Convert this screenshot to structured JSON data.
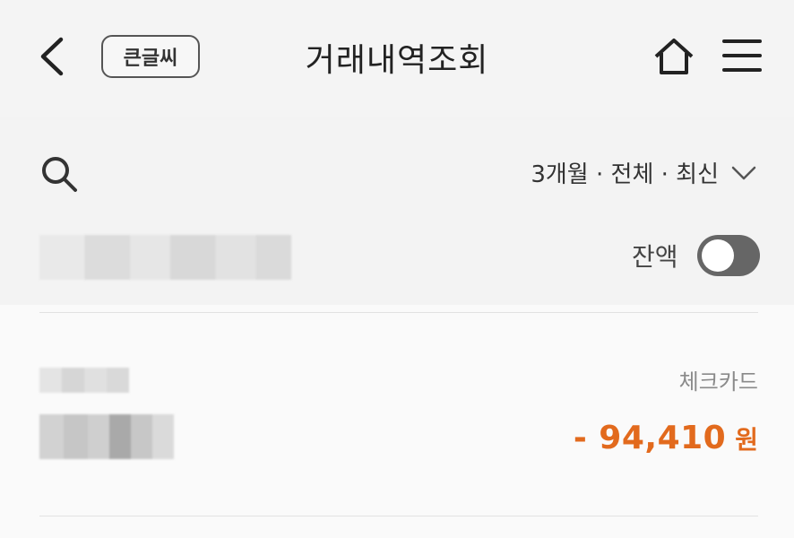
{
  "header": {
    "title": "거래내역조회",
    "big_font_label": "큰글씨",
    "icons": [
      "back-icon",
      "home-icon",
      "menu-icon"
    ]
  },
  "filter": {
    "summary": "3개월 · 전체 · 최신",
    "icons": [
      "search-icon",
      "chevron-down-icon"
    ]
  },
  "balance": {
    "label": "잔액",
    "toggle_on": false
  },
  "transactions": [
    {
      "type": "체크카드",
      "amount": "- 94,410",
      "unit": "원"
    }
  ],
  "colors": {
    "accent": "#e26a1d",
    "header_bg": "#f4f4f4",
    "toggle": "#666666"
  }
}
